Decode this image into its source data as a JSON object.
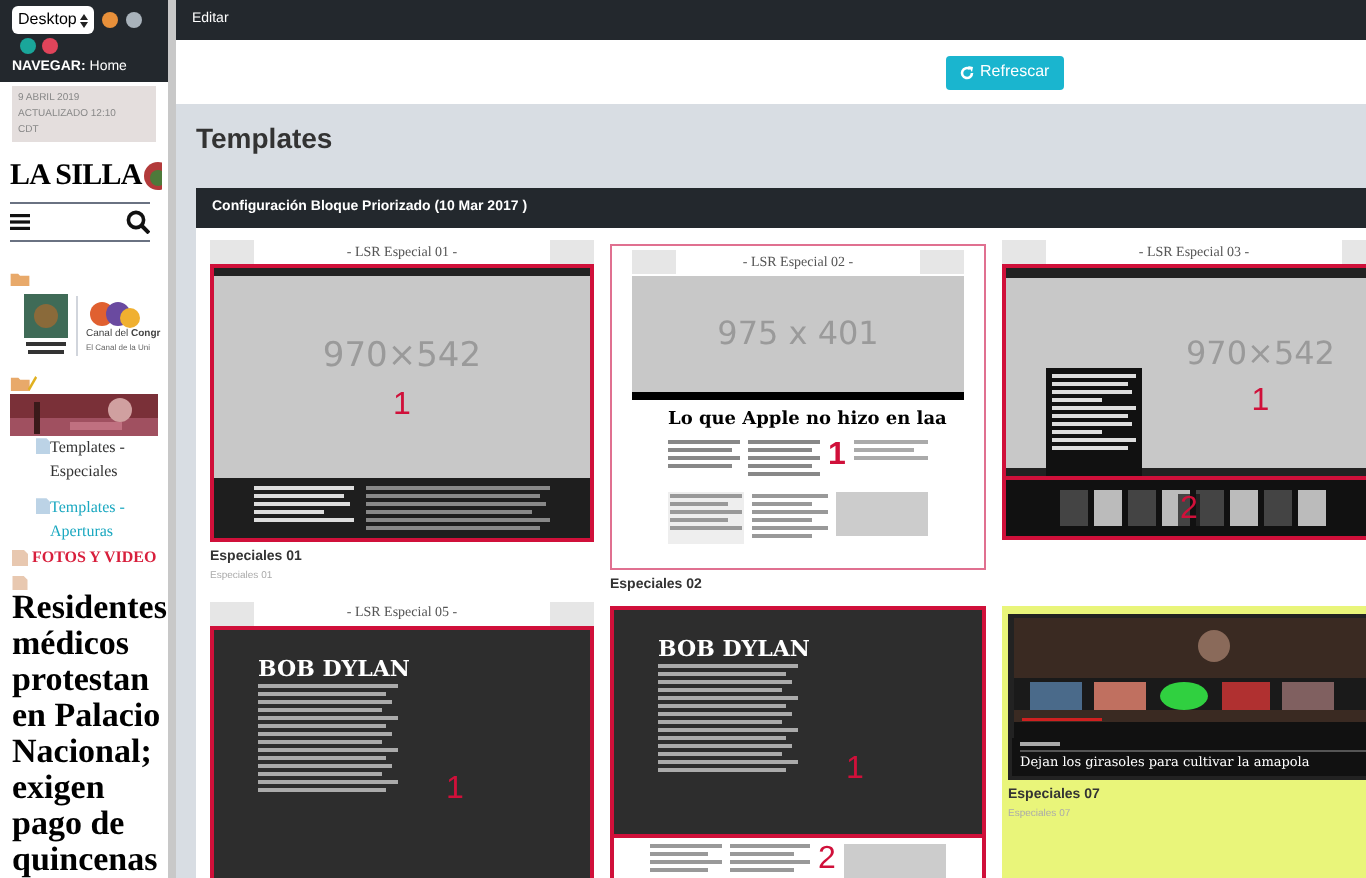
{
  "sidebar": {
    "device_select": "Desktop",
    "nav_label": "NAVEGAR:",
    "nav_value": "Home",
    "date_lines": [
      "9 ABRIL 2019",
      "ACTUALIZADO 12:10",
      "CDT"
    ],
    "logo": "LA SILLA",
    "partner_text": [
      "Canal del **Congr**",
      "El Canal de la Uni"
    ],
    "links": [
      {
        "text": "Templates - Especiales",
        "selected": false
      },
      {
        "text": "Templates - Aperturas",
        "selected": true
      }
    ],
    "section": "FOTOS Y VIDEO",
    "headline": "Residentes médicos protestan en Palacio Nacional; exigen pago de quincenas"
  },
  "topbar": {
    "title": "Editar"
  },
  "refresh_button": "Refrescar",
  "page_title": "Templates",
  "panel": {
    "title": "Configuración Bloque Priorizado (10 Mar 2017 )",
    "templates": [
      {
        "kind": "photo-band",
        "heading": "- LSR Especial 01 -",
        "placeholder": "970×542",
        "markers": [
          "1"
        ],
        "name": "Especiales 01",
        "subname": "Especiales 01",
        "selected": false
      },
      {
        "kind": "slider",
        "heading": "- LSR Especial 02 -",
        "placeholder": "975 x 401",
        "headline": "Lo que Apple no hizo en laa",
        "markers": [
          "1"
        ],
        "name": "Especiales 02",
        "selected": false
      },
      {
        "kind": "overlay",
        "heading": "- LSR Especial 03 -",
        "placeholder": "970×542",
        "markers": [
          "1",
          "2"
        ],
        "selected": false
      },
      {
        "kind": "dark",
        "heading": "- LSR Especial 05 -",
        "headline": "BOB DYLAN",
        "markers": [
          "1"
        ],
        "selected": false
      },
      {
        "kind": "dark-split",
        "headline": "BOB DYLAN",
        "markers": [
          "1",
          "2"
        ],
        "selected": false
      },
      {
        "kind": "video",
        "caption": "Dejan los girasoles para cultivar la amapola",
        "name": "Especiales 07",
        "subname": "Especiales 07",
        "selected": true
      }
    ]
  }
}
